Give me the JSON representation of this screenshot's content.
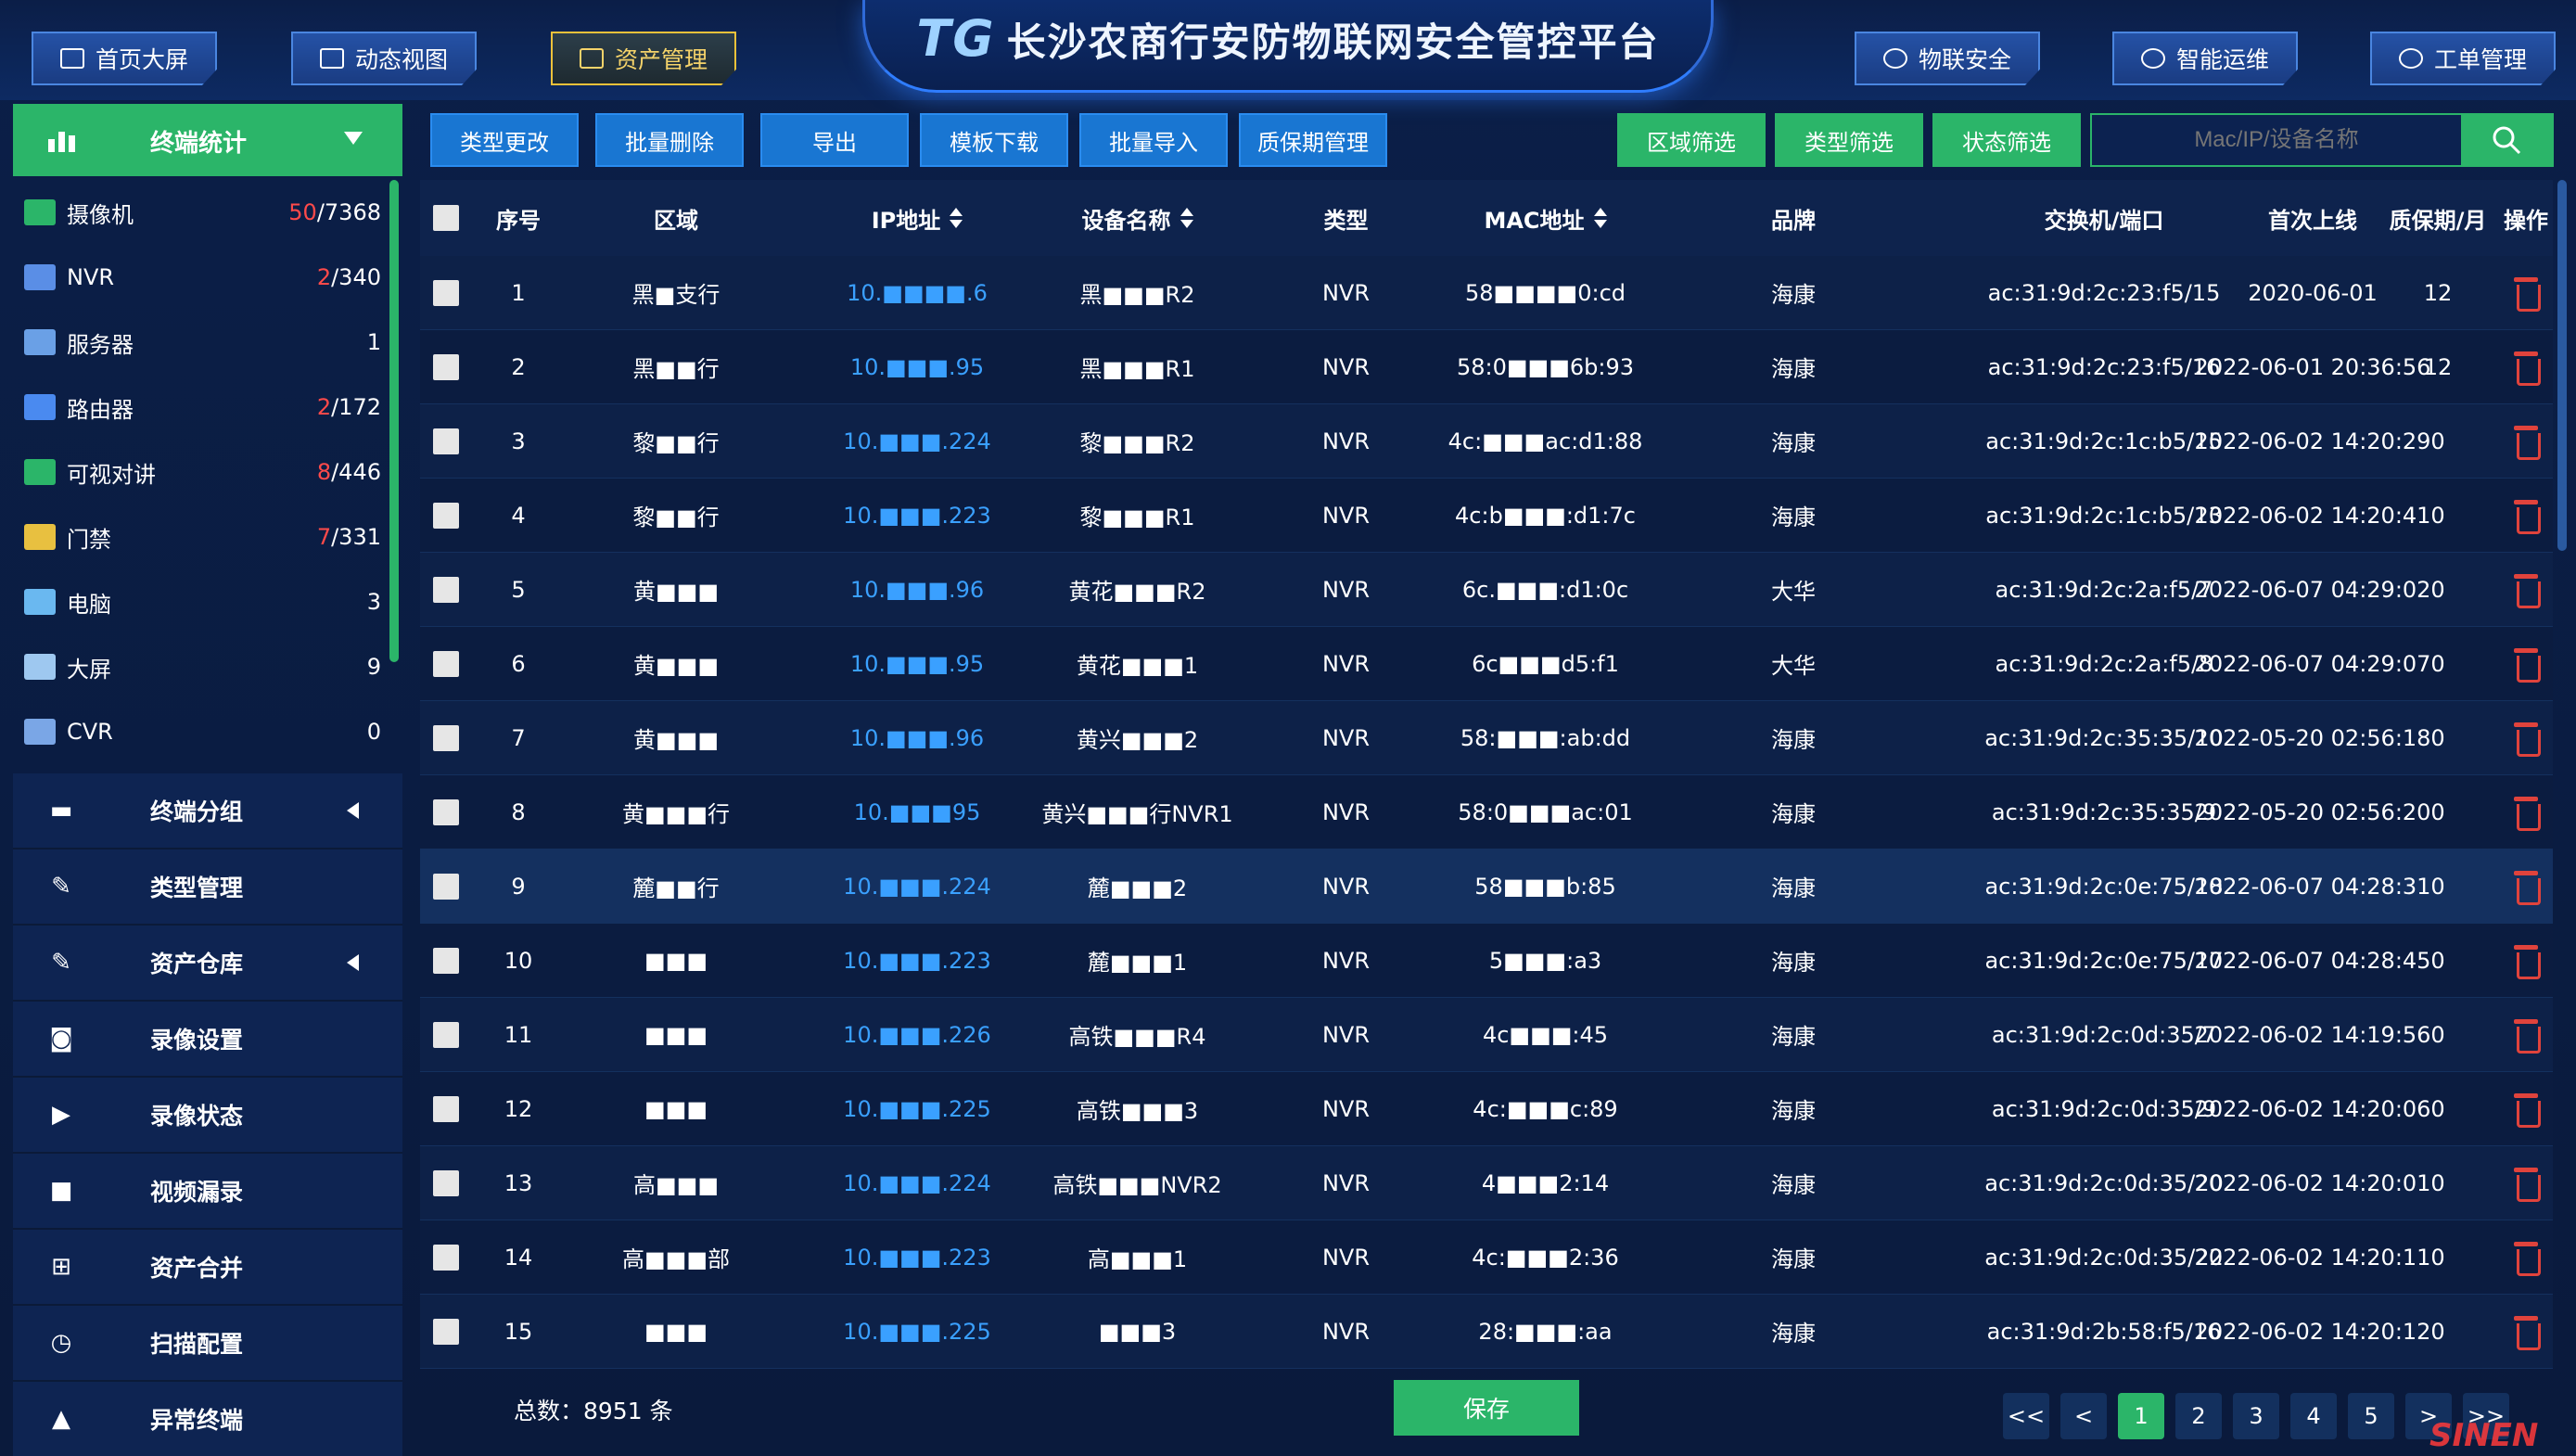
{
  "header": {
    "logo": "TG",
    "title": "长沙农商行安防物联网安全管控平台",
    "nav_left": [
      {
        "label": "首页大屏",
        "icon": "monitor-icon"
      },
      {
        "label": "动态视图",
        "icon": "chart-icon"
      },
      {
        "label": "资产管理",
        "icon": "bar-chart-icon",
        "active": true
      }
    ],
    "nav_right": [
      {
        "label": "物联安全",
        "icon": "shield-icon"
      },
      {
        "label": "智能运维",
        "icon": "globe-icon"
      },
      {
        "label": "工单管理",
        "icon": "document-icon"
      }
    ]
  },
  "sidebar": {
    "title": "终端统计",
    "stats": [
      {
        "label": "摄像机",
        "alert": "50",
        "total": "/7368",
        "icon": "camera-icon"
      },
      {
        "label": "NVR",
        "alert": "2",
        "total": "/340",
        "icon": "nvr-icon"
      },
      {
        "label": "服务器",
        "alert": "",
        "total": "1",
        "icon": "server-icon"
      },
      {
        "label": "路由器",
        "alert": "2",
        "total": "/172",
        "icon": "router-icon"
      },
      {
        "label": "可视对讲",
        "alert": "8",
        "total": "/446",
        "icon": "intercom-icon"
      },
      {
        "label": "门禁",
        "alert": "7",
        "total": "/331",
        "icon": "access-control-icon"
      },
      {
        "label": "电脑",
        "alert": "",
        "total": "3",
        "icon": "computer-icon"
      },
      {
        "label": "大屏",
        "alert": "",
        "total": "9",
        "icon": "screen-icon"
      },
      {
        "label": "CVR",
        "alert": "",
        "total": "0",
        "icon": "cvr-icon"
      }
    ],
    "menu": [
      {
        "label": "终端分组",
        "icon": "folder-icon",
        "arrow": true
      },
      {
        "label": "类型管理",
        "icon": "edit-icon",
        "arrow": false
      },
      {
        "label": "资产仓库",
        "icon": "edit-icon",
        "arrow": true
      },
      {
        "label": "录像设置",
        "icon": "video-camera-icon",
        "arrow": false
      },
      {
        "label": "录像状态",
        "icon": "play-icon",
        "arrow": false
      },
      {
        "label": "视频漏录",
        "icon": "video-icon",
        "arrow": false
      },
      {
        "label": "资产合并",
        "icon": "merge-icon",
        "arrow": false
      },
      {
        "label": "扫描配置",
        "icon": "scan-icon",
        "arrow": false
      },
      {
        "label": "异常终端",
        "icon": "warning-icon",
        "arrow": false
      }
    ]
  },
  "toolbar": {
    "actions": [
      "类型更改",
      "批量删除",
      "导出",
      "模板下载",
      "批量导入",
      "质保期管理"
    ],
    "filters": [
      "区域筛选",
      "类型筛选",
      "状态筛选"
    ],
    "search_placeholder": "Mac/IP/设备名称"
  },
  "table": {
    "headers": [
      "序号",
      "区域",
      "IP地址",
      "设备名称",
      "类型",
      "MAC地址",
      "品牌",
      "交换机/端口",
      "首次上线",
      "质保期/月",
      "操作"
    ],
    "rows": [
      {
        "no": "1",
        "region": "黑■支行",
        "ip": "10.■■■■.6",
        "name": "黑■■■R2",
        "type": "NVR",
        "mac": "58■■■■0:cd",
        "brand": "海康",
        "switch": "ac:31:9d:2c:23:f5/15",
        "first": "2020-06-01",
        "warranty": "12"
      },
      {
        "no": "2",
        "region": "黑■■行",
        "ip": "10.■■■.95",
        "name": "黑■■■R1",
        "type": "NVR",
        "mac": "58:0■■■6b:93",
        "brand": "海康",
        "switch": "ac:31:9d:2c:23:f5/16",
        "first": "2022-06-01 20:36:56",
        "warranty": "12"
      },
      {
        "no": "3",
        "region": "黎■■行",
        "ip": "10.■■■.224",
        "name": "黎■■■R2",
        "type": "NVR",
        "mac": "4c:■■■ac:d1:88",
        "brand": "海康",
        "switch": "ac:31:9d:2c:1c:b5/15",
        "first": "2022-06-02 14:20:29",
        "warranty": "0"
      },
      {
        "no": "4",
        "region": "黎■■行",
        "ip": "10.■■■.223",
        "name": "黎■■■R1",
        "type": "NVR",
        "mac": "4c:b■■■:d1:7c",
        "brand": "海康",
        "switch": "ac:31:9d:2c:1c:b5/13",
        "first": "2022-06-02 14:20:41",
        "warranty": "0"
      },
      {
        "no": "5",
        "region": "黄■■■",
        "ip": "10.■■■.96",
        "name": "黄花■■■R2",
        "type": "NVR",
        "mac": "6c.■■■:d1:0c",
        "brand": "大华",
        "switch": "ac:31:9d:2c:2a:f5/7",
        "first": "2022-06-07 04:29:02",
        "warranty": "0"
      },
      {
        "no": "6",
        "region": "黄■■■",
        "ip": "10.■■■.95",
        "name": "黄花■■■1",
        "type": "NVR",
        "mac": "6c■■■d5:f1",
        "brand": "大华",
        "switch": "ac:31:9d:2c:2a:f5/8",
        "first": "2022-06-07 04:29:07",
        "warranty": "0"
      },
      {
        "no": "7",
        "region": "黄■■■",
        "ip": "10.■■■.96",
        "name": "黄兴■■■2",
        "type": "NVR",
        "mac": "58:■■■:ab:dd",
        "brand": "海康",
        "switch": "ac:31:9d:2c:35:35/10",
        "first": "2022-05-20 02:56:18",
        "warranty": "0"
      },
      {
        "no": "8",
        "region": "黄■■■行",
        "ip": "10.■■■95",
        "name": "黄兴■■■行NVR1",
        "type": "NVR",
        "mac": "58:0■■■ac:01",
        "brand": "海康",
        "switch": "ac:31:9d:2c:35:35/9",
        "first": "2022-05-20 02:56:20",
        "warranty": "0"
      },
      {
        "no": "9",
        "region": "麓■■行",
        "ip": "10.■■■.224",
        "name": "麓■■■2",
        "type": "NVR",
        "mac": "58■■■b:85",
        "brand": "海康",
        "switch": "ac:31:9d:2c:0e:75/18",
        "first": "2022-06-07 04:28:31",
        "warranty": "0"
      },
      {
        "no": "10",
        "region": "■■■",
        "ip": "10.■■■.223",
        "name": "麓■■■1",
        "type": "NVR",
        "mac": "5■■■:a3",
        "brand": "海康",
        "switch": "ac:31:9d:2c:0e:75/17",
        "first": "2022-06-07 04:28:45",
        "warranty": "0"
      },
      {
        "no": "11",
        "region": "■■■",
        "ip": "10.■■■.226",
        "name": "高铁■■■R4",
        "type": "NVR",
        "mac": "4c■■■:45",
        "brand": "海康",
        "switch": "ac:31:9d:2c:0d:35/7",
        "first": "2022-06-02 14:19:56",
        "warranty": "0"
      },
      {
        "no": "12",
        "region": "■■■",
        "ip": "10.■■■.225",
        "name": "高铁■■■3",
        "type": "NVR",
        "mac": "4c:■■■c:89",
        "brand": "海康",
        "switch": "ac:31:9d:2c:0d:35/9",
        "first": "2022-06-02 14:20:06",
        "warranty": "0"
      },
      {
        "no": "13",
        "region": "高■■■",
        "ip": "10.■■■.224",
        "name": "高铁■■■NVR2",
        "type": "NVR",
        "mac": "4■■■2:14",
        "brand": "海康",
        "switch": "ac:31:9d:2c:0d:35/20",
        "first": "2022-06-02 14:20:01",
        "warranty": "0"
      },
      {
        "no": "14",
        "region": "高■■■部",
        "ip": "10.■■■.223",
        "name": "高■■■1",
        "type": "NVR",
        "mac": "4c:■■■2:36",
        "brand": "海康",
        "switch": "ac:31:9d:2c:0d:35/22",
        "first": "2022-06-02 14:20:11",
        "warranty": "0"
      },
      {
        "no": "15",
        "region": "■■■",
        "ip": "10.■■■.225",
        "name": "■■■3",
        "type": "NVR",
        "mac": "28:■■■:aa",
        "brand": "海康",
        "switch": "ac:31:9d:2b:58:f5/16",
        "first": "2022-06-02 14:20:12",
        "warranty": "0"
      }
    ]
  },
  "footer": {
    "total": "总数：8951 条",
    "save": "保存",
    "pages": [
      "<<",
      "<",
      "1",
      "2",
      "3",
      "4",
      "5",
      ">",
      ">>"
    ],
    "current_page": "1"
  },
  "watermark": "SINEN",
  "colors": {
    "accent_green": "#2bb569",
    "button_blue": "#1976d2",
    "alert_red": "#ff4a4a",
    "delete_red": "#e0433c",
    "ip_blue": "#3aa0ff"
  }
}
